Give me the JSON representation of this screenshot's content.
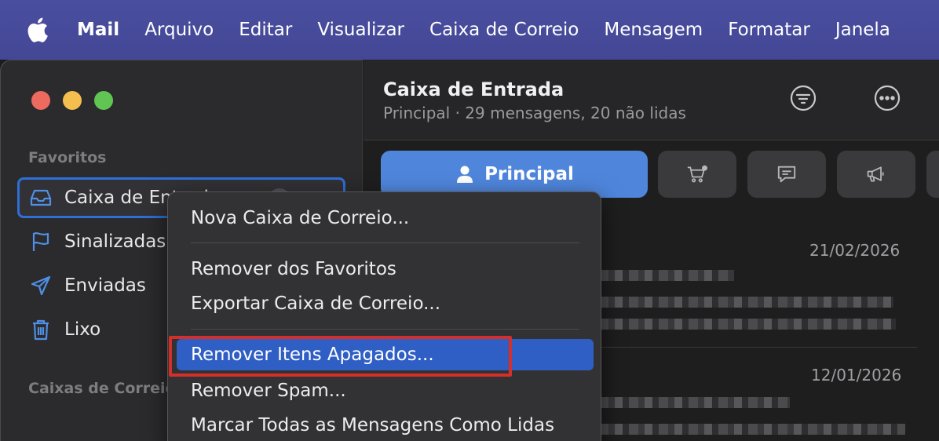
{
  "menubar": {
    "app_name": "Mail",
    "items": [
      "Arquivo",
      "Editar",
      "Visualizar",
      "Caixa de Correio",
      "Mensagem",
      "Formatar",
      "Janela"
    ]
  },
  "sidebar": {
    "favorites_label": "Favoritos",
    "items": [
      {
        "label": "Caixa de Entrada",
        "icon": "inbox-icon",
        "selected": true
      },
      {
        "label": "Sinalizadas",
        "icon": "flag-icon"
      },
      {
        "label": "Enviadas",
        "icon": "paper-plane-icon"
      },
      {
        "label": "Lixo",
        "icon": "trash-icon"
      }
    ],
    "mailboxes_label": "Caixas de Correio"
  },
  "main": {
    "title": "Caixa de Entrada",
    "subtitle": "Principal · 29 mensagens, 20 não lidas",
    "tabs": [
      {
        "label": "Principal",
        "icon": "person-icon",
        "active": true
      },
      {
        "label": "",
        "icon": "shopping-cart-icon"
      },
      {
        "label": "",
        "icon": "chat-bubble-icon"
      },
      {
        "label": "",
        "icon": "megaphone-icon"
      }
    ],
    "messages": [
      {
        "date": "21/02/2026"
      },
      {
        "date": "12/01/2026"
      }
    ]
  },
  "context_menu": {
    "items": [
      {
        "label": "Nova Caixa de Correio..."
      },
      {
        "label": "Remover dos Favoritos"
      },
      {
        "label": "Exportar Caixa de Correio..."
      },
      {
        "label": "Remover Itens Apagados...",
        "highlighted": true
      },
      {
        "label": "Remover Spam..."
      },
      {
        "label": "Marcar Todas as Mensagens Como Lidas"
      }
    ]
  },
  "colors": {
    "menubar": "#4a4e9e",
    "accent": "#4f86dc",
    "highlight": "#2f5ec4",
    "annotation": "#d42f2a"
  }
}
